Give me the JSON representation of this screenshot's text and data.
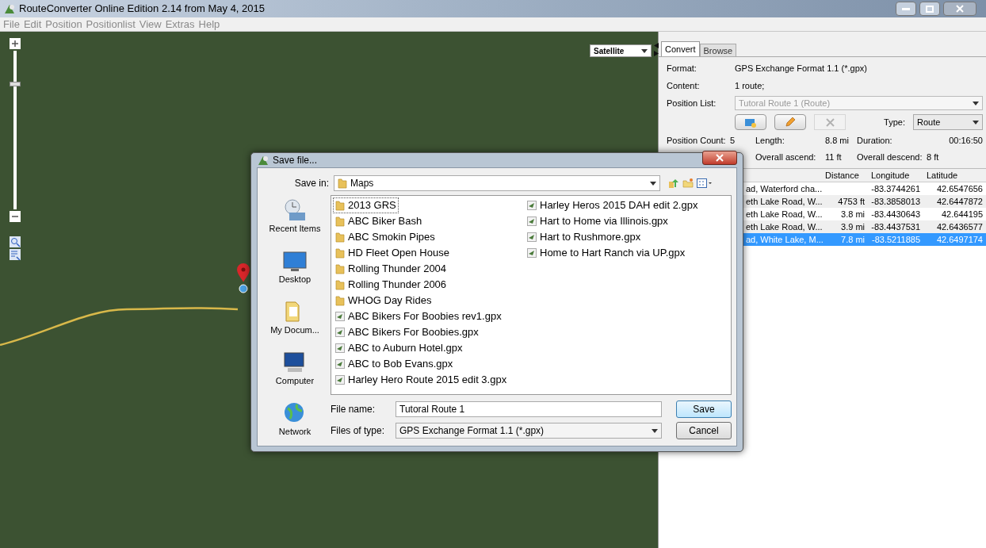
{
  "window": {
    "title": "RouteConverter Online Edition 2.14 from May 4, 2015"
  },
  "menu": [
    "File",
    "Edit",
    "Position",
    "Positionlist",
    "View",
    "Extras",
    "Help"
  ],
  "map": {
    "layer": "Satellite",
    "zoom": {
      "level": 0.8
    }
  },
  "panel": {
    "tabs": [
      {
        "label": "Convert",
        "selected": true
      },
      {
        "label": "Browse",
        "selected": false
      }
    ],
    "format_label": "Format:",
    "format": "GPS Exchange Format 1.1 (*.gpx)",
    "content_label": "Content:",
    "content": "1 route;",
    "position_list_label": "Position List:",
    "position_list": "Tutoral Route 1 (Route)",
    "tools": [
      {
        "kind": "add",
        "disabled": false
      },
      {
        "kind": "rename",
        "disabled": false
      },
      {
        "kind": "delete",
        "disabled": true
      }
    ],
    "type_label": "Type:",
    "type": "Route",
    "stats": [
      {
        "label": "Position Count:",
        "value": "5"
      },
      {
        "label": "Length:",
        "value": "8.8 mi"
      },
      {
        "label": "Duration:",
        "value": "00:16:50"
      },
      {
        "label": "Overall ascend:",
        "value": "11 ft"
      },
      {
        "label": "Overall descend:",
        "value": "8 ft"
      }
    ],
    "table": {
      "columns": [
        "",
        "Distance",
        "Longitude",
        "Latitude"
      ],
      "rows": [
        {
          "cells": [
            "ad, Waterford cha...",
            "",
            "-83.3744261",
            "42.6547656"
          ],
          "selected": false
        },
        {
          "cells": [
            "eth Lake Road, W...",
            "4753 ft",
            "-83.3858013",
            "42.6447872"
          ],
          "selected": false
        },
        {
          "cells": [
            "eth Lake Road, W...",
            "3.8 mi",
            "-83.4430643",
            "42.644195"
          ],
          "selected": false
        },
        {
          "cells": [
            "eth Lake Road, W...",
            "3.9 mi",
            "-83.4437531",
            "42.6436577"
          ],
          "selected": false
        },
        {
          "cells": [
            "ad, White Lake, M...",
            "7.8 mi",
            "-83.5211885",
            "42.6497174"
          ],
          "selected": true
        }
      ]
    }
  },
  "dialog": {
    "title": "Save file...",
    "save_in_label": "Save in:",
    "save_in": "Maps",
    "places": [
      {
        "kind": "recent",
        "label": "Recent Items"
      },
      {
        "kind": "desktop",
        "label": "Desktop"
      },
      {
        "kind": "documents",
        "label": "My Docum..."
      },
      {
        "kind": "computer",
        "label": "Computer"
      },
      {
        "kind": "network",
        "label": "Network"
      }
    ],
    "files": [
      {
        "kind": "folder",
        "name": "2013 GRS",
        "selected": true
      },
      {
        "kind": "folder",
        "name": "ABC Biker Bash",
        "selected": false
      },
      {
        "kind": "folder",
        "name": "ABC Smokin Pipes",
        "selected": false
      },
      {
        "kind": "folder",
        "name": "HD Fleet Open House",
        "selected": false
      },
      {
        "kind": "folder",
        "name": "Rolling Thunder 2004",
        "selected": false
      },
      {
        "kind": "folder",
        "name": "Rolling Thunder 2006",
        "selected": false
      },
      {
        "kind": "folder",
        "name": "WHOG Day Rides",
        "selected": false
      },
      {
        "kind": "file",
        "name": "ABC Bikers For Boobies rev1.gpx",
        "selected": false
      },
      {
        "kind": "file",
        "name": "ABC Bikers For Boobies.gpx",
        "selected": false
      },
      {
        "kind": "file",
        "name": "ABC to Auburn Hotel.gpx",
        "selected": false
      },
      {
        "kind": "file",
        "name": "ABC to Bob Evans.gpx",
        "selected": false
      },
      {
        "kind": "file",
        "name": "Harley Hero Route 2015 edit 3.gpx",
        "selected": false
      },
      {
        "kind": "file",
        "name": "Harley Heros 2015 DAH edit 2.gpx",
        "selected": false
      },
      {
        "kind": "file",
        "name": "Hart to Home via Illinois.gpx",
        "selected": false
      },
      {
        "kind": "file",
        "name": "Hart to Rushmore.gpx",
        "selected": false
      },
      {
        "kind": "file",
        "name": "Home to Hart Ranch via UP.gpx",
        "selected": false
      }
    ],
    "file_name_label": "File name:",
    "file_name": "Tutoral Route 1",
    "file_type_label": "Files of type:",
    "file_type": "GPS Exchange Format 1.1 (*.gpx)",
    "buttons": [
      "Save",
      "Cancel"
    ]
  }
}
